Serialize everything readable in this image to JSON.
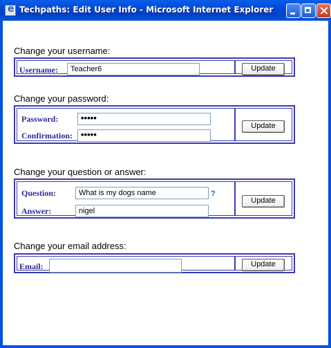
{
  "window": {
    "title": "Techpaths: Edit User Info - Microsoft Internet Explorer"
  },
  "username_section": {
    "heading": "Change your username:",
    "label": "Username:",
    "value": "Teacher6",
    "button": "Update"
  },
  "password_section": {
    "heading": "Change your password:",
    "password_label": "Password:",
    "password_value": "•••••",
    "confirmation_label": "Confirmation:",
    "confirmation_value": "•••••",
    "button": "Update"
  },
  "question_section": {
    "heading": "Change your question or answer:",
    "question_label": "Question:",
    "question_value": "What is my dogs name",
    "help_link": "?",
    "answer_label": "Answer:",
    "answer_value": "nigel",
    "button": "Update"
  },
  "email_section": {
    "heading": "Change your email address:",
    "label": "Email:",
    "value": "",
    "button": "Update"
  }
}
